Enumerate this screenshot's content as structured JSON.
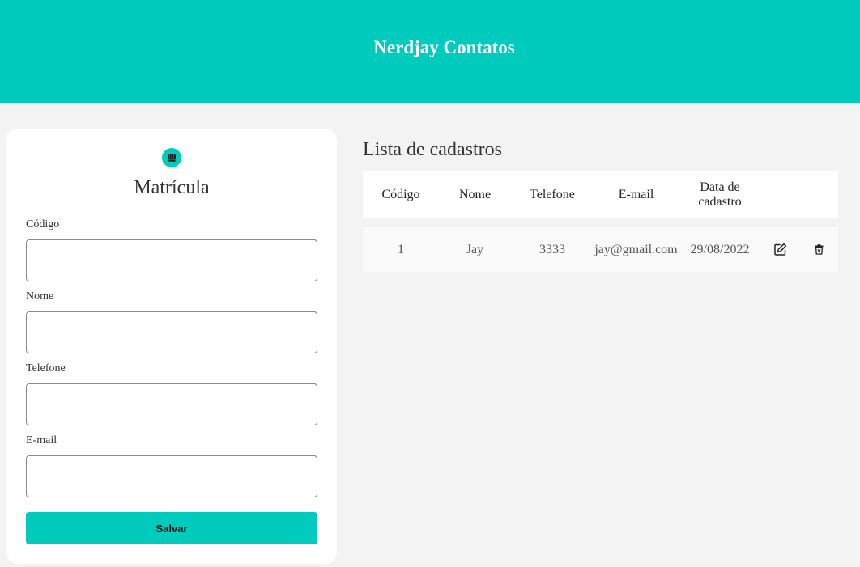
{
  "header": {
    "title": "Nerdjay Contatos"
  },
  "form": {
    "icon": "fist-icon",
    "title": "Matrícula",
    "fields": [
      {
        "label": "Código",
        "value": "",
        "placeholder": ""
      },
      {
        "label": "Nome",
        "value": "",
        "placeholder": ""
      },
      {
        "label": "Telefone",
        "value": "",
        "placeholder": ""
      },
      {
        "label": "E-mail",
        "value": "",
        "placeholder": ""
      }
    ],
    "save_label": "Salvar"
  },
  "list": {
    "title": "Lista de cadastros",
    "columns": [
      "Código",
      "Nome",
      "Telefone",
      "E-mail",
      "Data de cadastro"
    ],
    "rows": [
      {
        "codigo": "1",
        "nome": "Jay",
        "telefone": "3333",
        "email": "jay@gmail.com",
        "data": "29/08/2022",
        "edit_icon": "edit-icon",
        "delete_icon": "trash-icon"
      }
    ]
  },
  "colors": {
    "accent": "#00cbbd",
    "background": "#f3f3f3",
    "card": "#ffffff"
  }
}
